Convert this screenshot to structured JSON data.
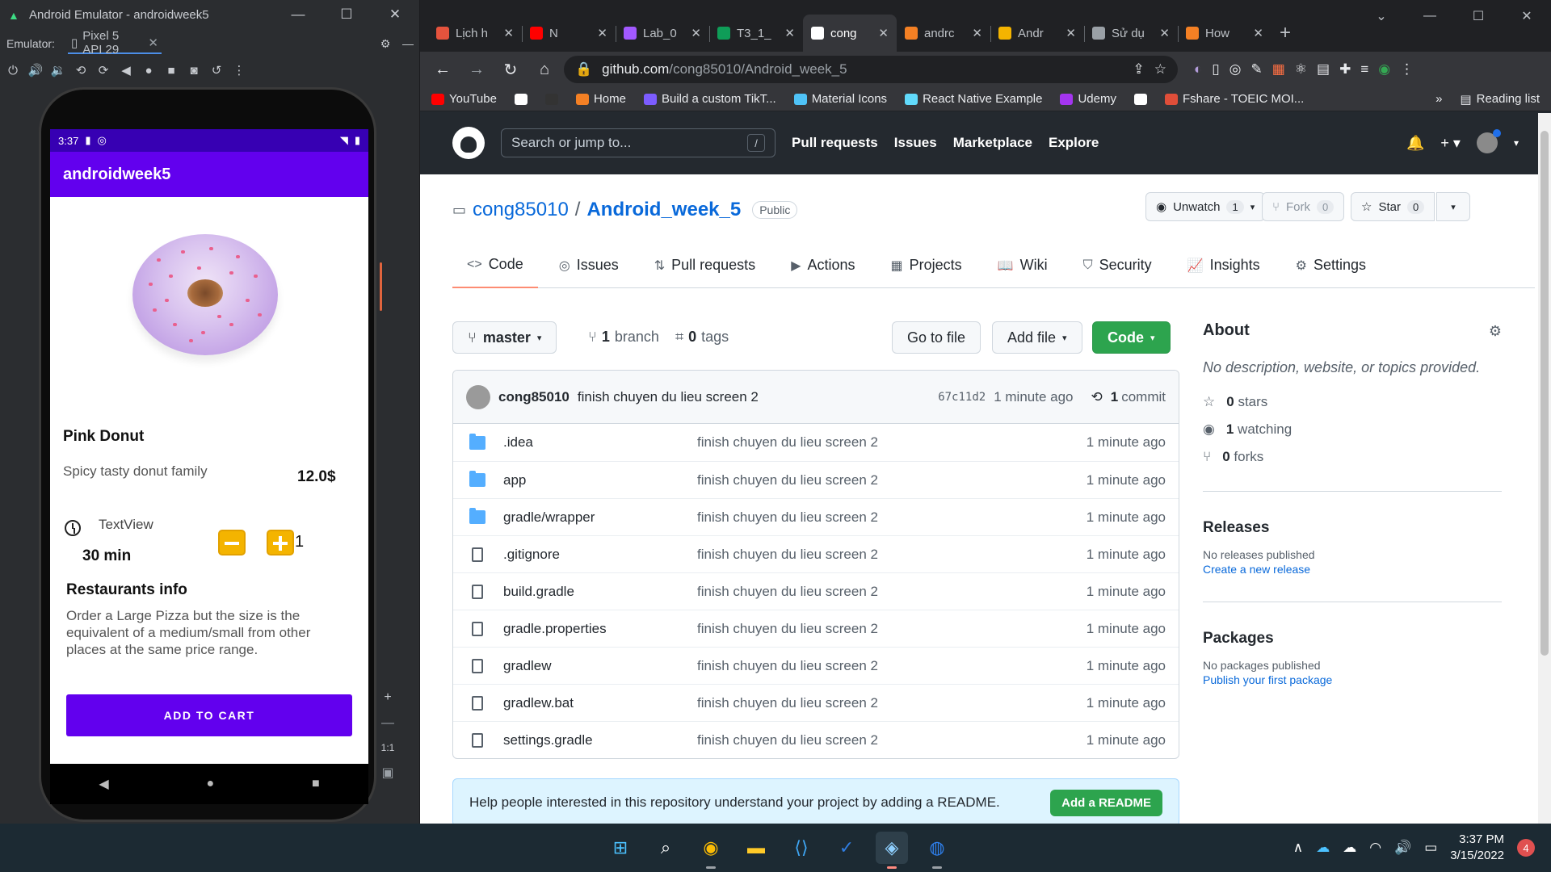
{
  "emulator": {
    "window_title": "Android Emulator - androidweek5",
    "label": "Emulator:",
    "device_tab": "Pixel 5 API 29",
    "status_time": "3:37",
    "app_title": "androidweek5",
    "product": {
      "name": "Pink Donut",
      "description": "Spicy tasty donut family",
      "price": "12.0$",
      "textview": "TextView",
      "time": "30 min",
      "quantity": "1",
      "info_title": "Restaurants info",
      "info_text": " Order a Large Pizza but the size is the\nequivalent of a medium/small from other\nplaces at the same price range.",
      "cart_button": "ADD TO CART"
    },
    "side_zoom_label": "1:1"
  },
  "chrome": {
    "tabs": [
      {
        "title": "Lịch h",
        "favicon_color": "#e5533d"
      },
      {
        "title": "N",
        "favicon_color": "#ff0000"
      },
      {
        "title": "Lab_0",
        "favicon_color": "#a259ff"
      },
      {
        "title": "T3_1_",
        "favicon_color": "#0f9d58"
      },
      {
        "title": "cong",
        "favicon_color": "#ffffff"
      },
      {
        "title": "andrc",
        "favicon_color": "#f48024"
      },
      {
        "title": "Andr",
        "favicon_color": "#f4b400"
      },
      {
        "title": "Sử dụ",
        "favicon_color": "#9aa0a6"
      },
      {
        "title": "How",
        "favicon_color": "#f48024"
      }
    ],
    "url_host": "github.com",
    "url_path": "/cong85010/Android_week_5",
    "bookmarks": [
      {
        "label": "YouTube",
        "color": "#ff0000"
      },
      {
        "label": "",
        "color": "#ffffff"
      },
      {
        "label": "",
        "color": "#333333"
      },
      {
        "label": "Home",
        "color": "#f48024"
      },
      {
        "label": "Build a custom TikT...",
        "color": "#7c5cff"
      },
      {
        "label": "Material Icons",
        "color": "#4fc3f7"
      },
      {
        "label": "React Native Example",
        "color": "#61dafb"
      },
      {
        "label": "Udemy",
        "color": "#a435f0"
      },
      {
        "label": "",
        "color": "#ffffff"
      },
      {
        "label": "Fshare - TOEIC MOI...",
        "color": "#e04e39"
      }
    ],
    "more_bookmarks": "»",
    "reading_list": "Reading list"
  },
  "github": {
    "search_placeholder": "Search or jump to...",
    "search_key": "/",
    "nav": [
      "Pull requests",
      "Issues",
      "Marketplace",
      "Explore"
    ],
    "owner": "cong85010",
    "repo": "Android_week_5",
    "visibility": "Public",
    "watch": {
      "label": "Unwatch",
      "count": "1"
    },
    "fork": {
      "label": "Fork",
      "count": "0"
    },
    "star": {
      "label": "Star",
      "count": "0"
    },
    "tabs": [
      "Code",
      "Issues",
      "Pull requests",
      "Actions",
      "Projects",
      "Wiki",
      "Security",
      "Insights",
      "Settings"
    ],
    "branch": "master",
    "branches_count": "1",
    "branches_label": "branch",
    "tags_count": "0",
    "tags_label": "tags",
    "go_to_file": "Go to file",
    "add_file": "Add file",
    "code_button": "Code",
    "commit": {
      "author": "cong85010",
      "message": "finish chuyen du lieu screen 2",
      "sha": "67c11d2",
      "ago": "1 minute ago",
      "count": "1",
      "count_label": "commit"
    },
    "files": [
      {
        "name": ".idea",
        "type": "dir",
        "message": "finish chuyen du lieu screen 2",
        "ago": "1 minute ago"
      },
      {
        "name": "app",
        "type": "dir",
        "message": "finish chuyen du lieu screen 2",
        "ago": "1 minute ago"
      },
      {
        "name": "gradle/wrapper",
        "type": "dir",
        "message": "finish chuyen du lieu screen 2",
        "ago": "1 minute ago"
      },
      {
        "name": ".gitignore",
        "type": "file",
        "message": "finish chuyen du lieu screen 2",
        "ago": "1 minute ago"
      },
      {
        "name": "build.gradle",
        "type": "file",
        "message": "finish chuyen du lieu screen 2",
        "ago": "1 minute ago"
      },
      {
        "name": "gradle.properties",
        "type": "file",
        "message": "finish chuyen du lieu screen 2",
        "ago": "1 minute ago"
      },
      {
        "name": "gradlew",
        "type": "file",
        "message": "finish chuyen du lieu screen 2",
        "ago": "1 minute ago"
      },
      {
        "name": "gradlew.bat",
        "type": "file",
        "message": "finish chuyen du lieu screen 2",
        "ago": "1 minute ago"
      },
      {
        "name": "settings.gradle",
        "type": "file",
        "message": "finish chuyen du lieu screen 2",
        "ago": "1 minute ago"
      }
    ],
    "readme_prompt": "Help people interested in this repository understand your project by adding a README.",
    "add_readme": "Add a README",
    "about": {
      "title": "About",
      "description": "No description, website, or topics provided.",
      "stars": "0",
      "stars_label": "stars",
      "watching": "1",
      "watching_label": "watching",
      "forks": "0",
      "forks_label": "forks",
      "releases_title": "Releases",
      "releases_text": "No releases published",
      "releases_link": "Create a new release",
      "packages_title": "Packages",
      "packages_text": "No packages published",
      "packages_link": "Publish your first package"
    }
  },
  "taskbar": {
    "time": "3:37 PM",
    "date": "3/15/2022",
    "notifications": "4"
  }
}
